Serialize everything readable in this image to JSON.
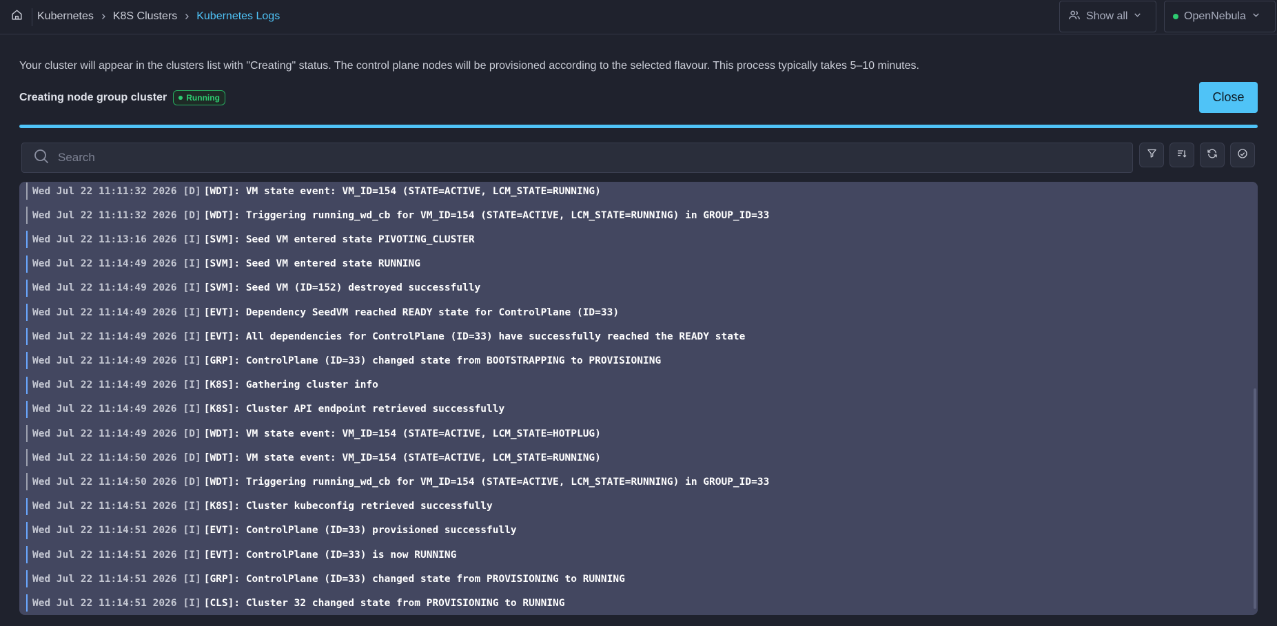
{
  "breadcrumb": {
    "items": [
      "Kubernetes",
      "K8S Clusters",
      "Kubernetes Logs"
    ]
  },
  "top_actions": {
    "show_all_label": "Show all",
    "cloud_label": "OpenNebula"
  },
  "intro_text": "Your cluster will appear in the clusters list with \"Creating\" status. The control plane nodes will be provisioned according to the selected flavour. This process typically takes 5–10 minutes.",
  "status": {
    "title": "Creating node group cluster",
    "badge": "Running",
    "progress_percent": 100
  },
  "close_label": "Close",
  "search": {
    "placeholder": "Search",
    "value": ""
  },
  "toolbar": {
    "icons": [
      "filter-icon",
      "sort-icon",
      "refresh-icon",
      "auto-scroll-icon"
    ]
  },
  "colors": {
    "accent": "#4fc3f7",
    "running_green": "#2ecc71",
    "log_background": "#434760"
  },
  "logs": [
    {
      "ts": "Wed Jul 22 11:11:32 2026",
      "level": "[D]",
      "msg": "[WDT]: VM state event: VM_ID=154 (STATE=ACTIVE, LCM_STATE=RUNNING)"
    },
    {
      "ts": "Wed Jul 22 11:11:32 2026",
      "level": "[D]",
      "msg": "[WDT]: Triggering running_wd_cb for VM_ID=154 (STATE=ACTIVE, LCM_STATE=RUNNING) in GROUP_ID=33"
    },
    {
      "ts": "Wed Jul 22 11:13:16 2026",
      "level": "[I]",
      "msg": "[SVM]: Seed VM entered state PIVOTING_CLUSTER"
    },
    {
      "ts": "Wed Jul 22 11:14:49 2026",
      "level": "[I]",
      "msg": "[SVM]: Seed VM entered state RUNNING"
    },
    {
      "ts": "Wed Jul 22 11:14:49 2026",
      "level": "[I]",
      "msg": "[SVM]: Seed VM (ID=152) destroyed successfully"
    },
    {
      "ts": "Wed Jul 22 11:14:49 2026",
      "level": "[I]",
      "msg": "[EVT]: Dependency SeedVM reached READY state for ControlPlane (ID=33)"
    },
    {
      "ts": "Wed Jul 22 11:14:49 2026",
      "level": "[I]",
      "msg": "[EVT]: All dependencies for ControlPlane (ID=33) have successfully reached the READY state"
    },
    {
      "ts": "Wed Jul 22 11:14:49 2026",
      "level": "[I]",
      "msg": "[GRP]: ControlPlane (ID=33) changed state from BOOTSTRAPPING to PROVISIONING"
    },
    {
      "ts": "Wed Jul 22 11:14:49 2026",
      "level": "[I]",
      "msg": "[K8S]: Gathering cluster info"
    },
    {
      "ts": "Wed Jul 22 11:14:49 2026",
      "level": "[I]",
      "msg": "[K8S]: Cluster API endpoint retrieved successfully"
    },
    {
      "ts": "Wed Jul 22 11:14:49 2026",
      "level": "[D]",
      "msg": "[WDT]: VM state event: VM_ID=154 (STATE=ACTIVE, LCM_STATE=HOTPLUG)"
    },
    {
      "ts": "Wed Jul 22 11:14:50 2026",
      "level": "[D]",
      "msg": "[WDT]: VM state event: VM_ID=154 (STATE=ACTIVE, LCM_STATE=RUNNING)"
    },
    {
      "ts": "Wed Jul 22 11:14:50 2026",
      "level": "[D]",
      "msg": "[WDT]: Triggering running_wd_cb for VM_ID=154 (STATE=ACTIVE, LCM_STATE=RUNNING) in GROUP_ID=33"
    },
    {
      "ts": "Wed Jul 22 11:14:51 2026",
      "level": "[I]",
      "msg": "[K8S]: Cluster kubeconfig retrieved successfully"
    },
    {
      "ts": "Wed Jul 22 11:14:51 2026",
      "level": "[I]",
      "msg": "[EVT]: ControlPlane (ID=33) provisioned successfully"
    },
    {
      "ts": "Wed Jul 22 11:14:51 2026",
      "level": "[I]",
      "msg": "[EVT]: ControlPlane (ID=33) is now RUNNING"
    },
    {
      "ts": "Wed Jul 22 11:14:51 2026",
      "level": "[I]",
      "msg": "[GRP]: ControlPlane (ID=33) changed state from PROVISIONING to RUNNING"
    },
    {
      "ts": "Wed Jul 22 11:14:51 2026",
      "level": "[I]",
      "msg": "[CLS]: Cluster 32 changed state from PROVISIONING to RUNNING"
    }
  ]
}
